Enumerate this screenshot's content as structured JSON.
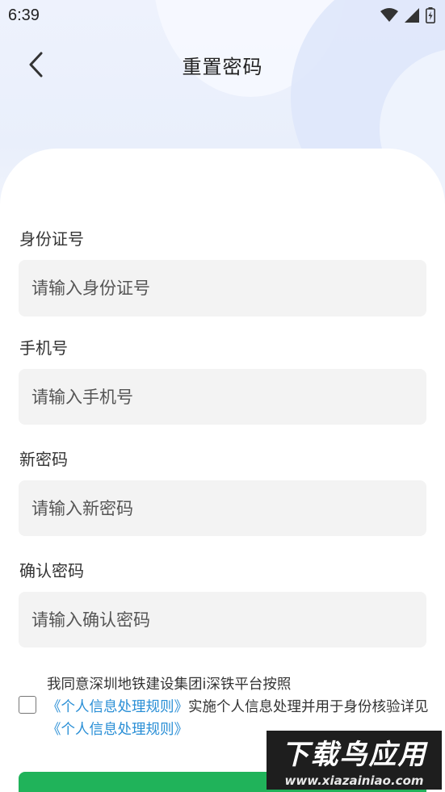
{
  "status_bar": {
    "time": "6:39",
    "icons": [
      "wifi-icon",
      "cellular-signal-icon",
      "battery-charging-icon"
    ]
  },
  "header": {
    "title": "重置密码",
    "back_icon": "chevron-left-icon"
  },
  "form": {
    "id_card": {
      "label": "身份证号",
      "placeholder": "请输入身份证号",
      "value": ""
    },
    "phone": {
      "label": "手机号",
      "placeholder": "请输入手机号",
      "value": ""
    },
    "new_password": {
      "label": "新密码",
      "placeholder": "请输入新密码",
      "value": ""
    },
    "confirm_password": {
      "label": "确认密码",
      "placeholder": "请输入确认密码",
      "value": ""
    }
  },
  "agreement": {
    "checked": false,
    "text_1": "我同意深圳地铁建设集团i深铁平台按照",
    "link_1": "《个人信息处理规则》",
    "text_2": "实施个人信息处理并用于身份核验详见",
    "link_2": "《个人信息处理规则》"
  },
  "submit": {
    "label": ""
  },
  "watermark": {
    "title": "下载鸟应用",
    "url": "www.xiazainiao.com"
  },
  "colors": {
    "accent_green": "#20b35a",
    "link_blue": "#2a8fd6",
    "input_bg": "#f3f3f3"
  }
}
